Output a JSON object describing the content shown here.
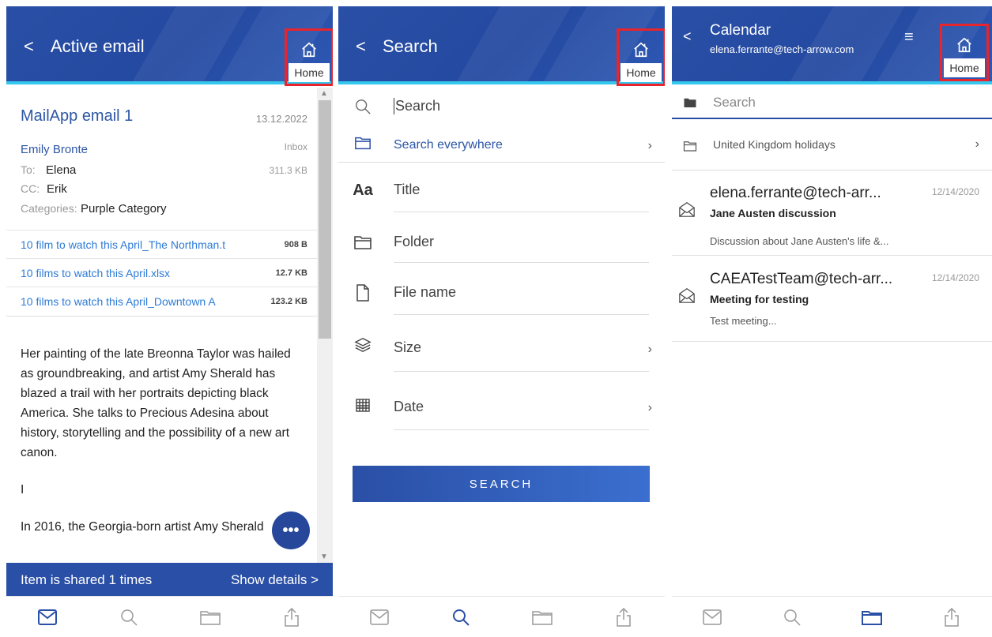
{
  "panels": {
    "email": {
      "back": "<",
      "title": "Active email",
      "home_label": "Home",
      "subject": "MailApp email 1",
      "date": "13.12.2022",
      "sender": "Emily Bronte",
      "folder": "Inbox",
      "to_label": "To:",
      "to_value": "Elena",
      "size": "311.3 KB",
      "cc_label": "CC:",
      "cc_value": "Erik",
      "categories_label": "Categories:",
      "categories_value": "Purple Category",
      "attachments": [
        {
          "name": "10 film to watch this April_The Northman.t",
          "size": "908 B"
        },
        {
          "name": "10 films to watch this April.xlsx",
          "size": "12.7 KB"
        },
        {
          "name": "10 films to watch this April_Downtown A",
          "size": "123.2 KB"
        }
      ],
      "body_p1": "Her painting of the late Breonna Taylor was hailed as groundbreaking, and artist Amy Sherald has blazed a trail with her portraits depicting black America. She talks to Precious Adesina about history, storytelling and the possibility of a new art canon.",
      "body_p2": "I",
      "body_p3": "In 2016, the Georgia-born artist Amy Sherald",
      "fab": "•••",
      "share_text": "Item is shared 1 times",
      "show_details": "Show details >"
    },
    "search": {
      "back": "<",
      "title": "Search",
      "home_label": "Home",
      "search_placeholder": "Search",
      "scope": "Search everywhere",
      "fields": [
        "Title",
        "Folder",
        "File name",
        "Size",
        "Date"
      ],
      "button": "SEARCH"
    },
    "calendar": {
      "back": "<",
      "title": "Calendar",
      "account": "elena.ferrante@tech-arrow.com",
      "home_label": "Home",
      "search_placeholder": "Search",
      "folder": "United Kingdom holidays",
      "messages": [
        {
          "from": "elena.ferrante@tech-arr...",
          "date": "12/14/2020",
          "subject": "Jane Austen discussion",
          "preview": "Discussion about Jane Austen's life &..."
        },
        {
          "from": "CAEATestTeam@tech-arr...",
          "date": "12/14/2020",
          "subject": "Meeting for testing",
          "preview": "Test meeting..."
        }
      ]
    }
  },
  "colors": {
    "header": "#2a4fa6",
    "accent_line": "#35c8ee",
    "highlight_box": "#e8242c",
    "link": "#2d56a5"
  },
  "icons": [
    "home-icon",
    "mail-icon",
    "search-icon",
    "folder-icon",
    "share-icon",
    "text-icon",
    "file-icon",
    "layers-icon",
    "calendar-icon",
    "menu-icon"
  ]
}
